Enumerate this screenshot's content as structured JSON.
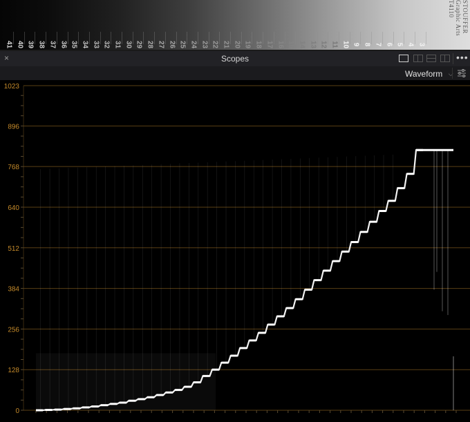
{
  "chart_data": {
    "type": "line",
    "x": [
      0,
      1,
      2,
      3,
      4,
      5,
      6,
      7,
      8,
      9,
      10,
      11,
      12,
      13,
      14,
      15,
      16,
      17,
      18,
      19,
      20,
      21,
      22,
      23,
      24,
      25,
      26,
      27,
      28,
      29,
      30,
      31,
      32,
      33,
      34,
      35,
      36,
      37,
      38,
      39,
      40,
      41
    ],
    "values": [
      0,
      1,
      2,
      4,
      6,
      9,
      12,
      16,
      20,
      24,
      30,
      35,
      41,
      48,
      56,
      64,
      74,
      88,
      108,
      128,
      150,
      172,
      196,
      220,
      244,
      270,
      296,
      322,
      350,
      380,
      410,
      440,
      470,
      500,
      530,
      562,
      594,
      628,
      660,
      700,
      745,
      820
    ],
    "ylim": [
      0,
      1023
    ],
    "yticks": [
      0,
      128,
      256,
      384,
      512,
      640,
      768,
      896,
      1023
    ],
    "grid": true
  },
  "wedge": {
    "steps": [
      "41",
      "40",
      "39",
      "38",
      "37",
      "36",
      "35",
      "34",
      "33",
      "32",
      "31",
      "30",
      "29",
      "28",
      "27",
      "26",
      "25",
      "24",
      "23",
      "22",
      "21",
      "20",
      "19",
      "18",
      "17",
      "16",
      "15",
      "14",
      "13",
      "12",
      "11",
      "10",
      "9",
      "8",
      "7",
      "6",
      "5",
      "4",
      "3"
    ],
    "brand": "STOUFFER  Graphic Arts  T4110"
  },
  "panel": {
    "title": "Scopes",
    "close": "×",
    "more": "•••",
    "scope_type": "Waveform"
  },
  "icons": {
    "close": "close-icon",
    "layout_single": "layout-single-icon",
    "layout_split": "layout-split-icon",
    "layout_quad": "layout-quad-icon",
    "more": "more-icon",
    "settings": "settings-sliders-icon"
  },
  "colors": {
    "grid_line": "#5a3f14",
    "tick_label": "#c58a2a",
    "trace": "#ffffff",
    "panel_bg": "#222226"
  }
}
